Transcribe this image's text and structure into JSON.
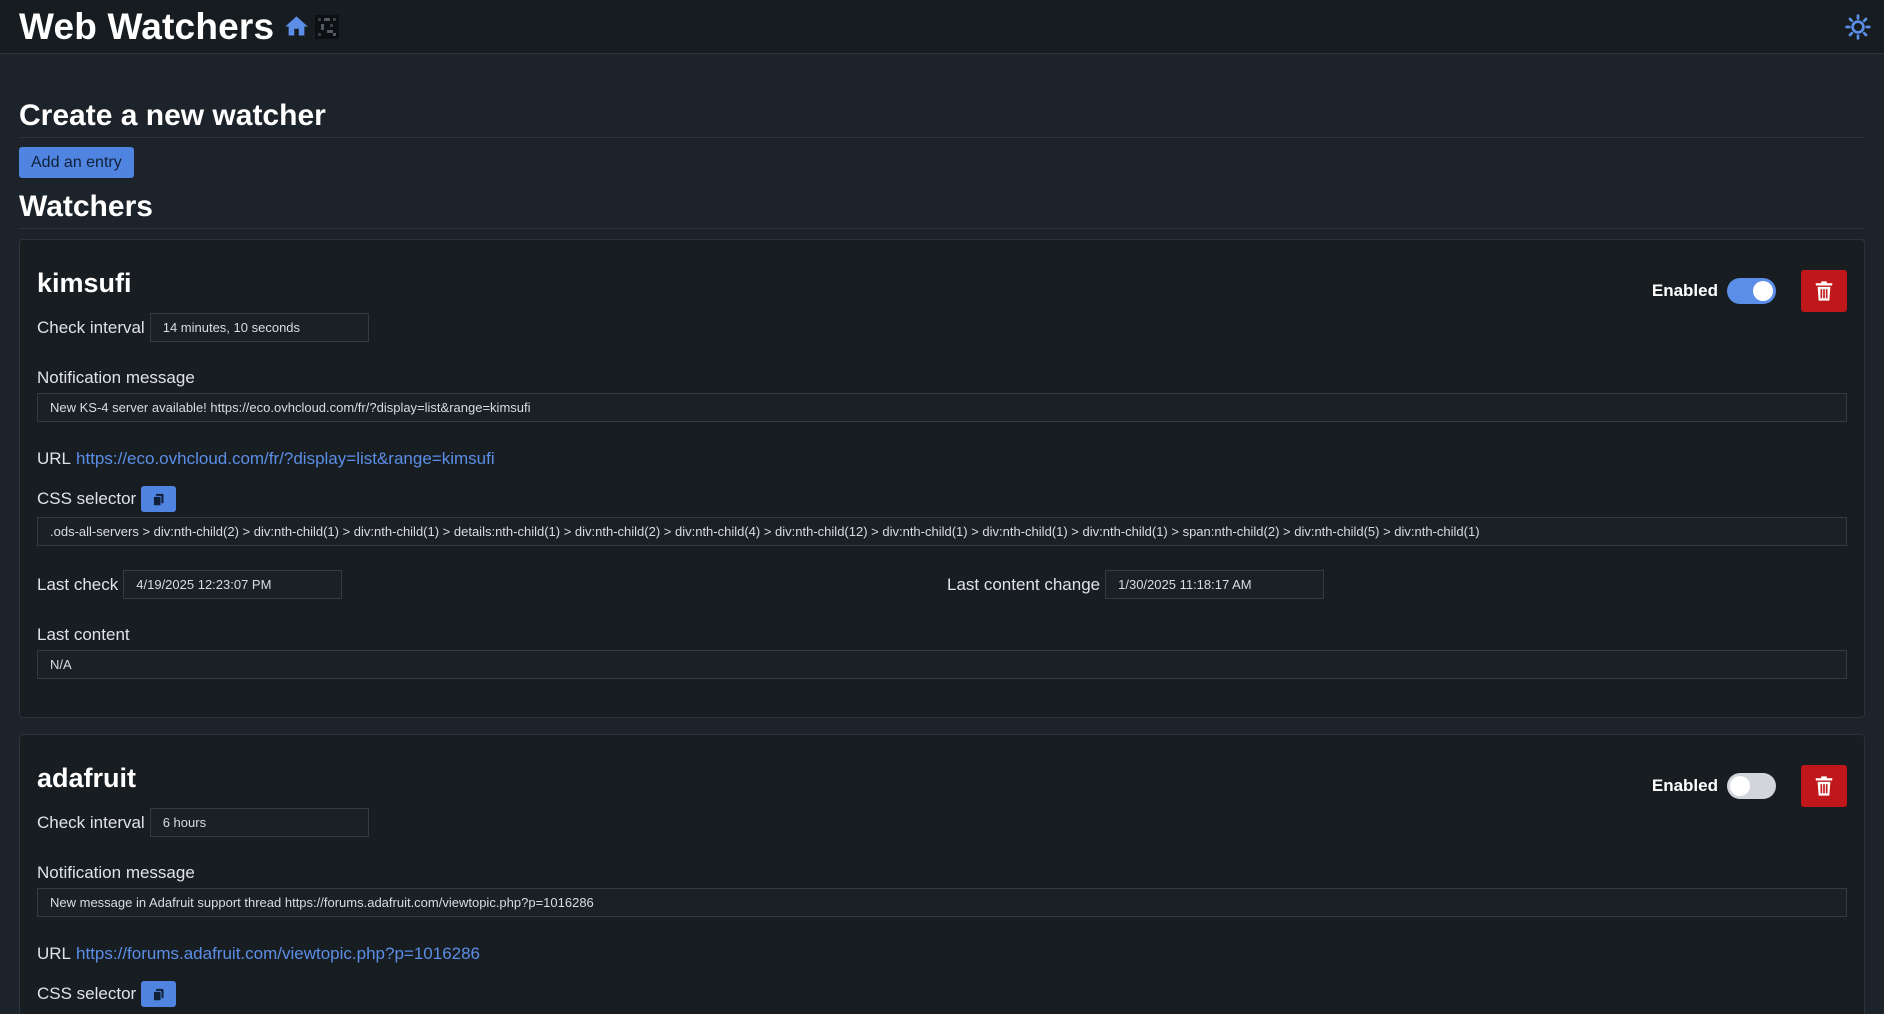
{
  "header": {
    "title": "Web Watchers"
  },
  "create": {
    "title": "Create a new watcher",
    "add_label": "Add an entry"
  },
  "watchers_title": "Watchers",
  "labels": {
    "enabled": "Enabled",
    "check_interval": "Check interval",
    "notification_message": "Notification message",
    "url": "URL",
    "css_selector": "CSS selector",
    "last_check": "Last check",
    "last_content_change": "Last content change",
    "last_content": "Last content"
  },
  "watchers": [
    {
      "name": "kimsufi",
      "enabled": true,
      "check_interval": "14 minutes, 10 seconds",
      "notification_message": "New KS-4 server available! https://eco.ovhcloud.com/fr/?display=list&range=kimsufi",
      "url": "https://eco.ovhcloud.com/fr/?display=list&range=kimsufi",
      "css_selector": ".ods-all-servers > div:nth-child(2) > div:nth-child(1) > div:nth-child(1) > details:nth-child(1) > div:nth-child(2) > div:nth-child(4) > div:nth-child(12) > div:nth-child(1) > div:nth-child(1) > div:nth-child(1) > span:nth-child(2) > div:nth-child(5) > div:nth-child(1)",
      "last_check": "4/19/2025 12:23:07 PM",
      "last_content_change": "1/30/2025 11:18:17 AM",
      "last_content": "N/A"
    },
    {
      "name": "adafruit",
      "enabled": false,
      "check_interval": "6 hours",
      "notification_message": "New message in Adafruit support thread https://forums.adafruit.com/viewtopic.php?p=1016286",
      "url": "https://forums.adafruit.com/viewtopic.php?p=1016286"
    }
  ],
  "colors": {
    "accent": "#5b8ee6",
    "danger": "#c0171a",
    "background": "#1d232a"
  },
  "icons": [
    "home-icon",
    "pixel-logo-icon",
    "theme-toggle-icon",
    "trash-icon",
    "copy-icon"
  ]
}
